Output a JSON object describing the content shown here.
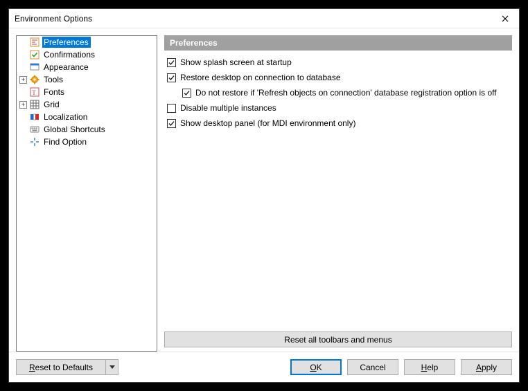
{
  "window": {
    "title": "Environment Options"
  },
  "tree": {
    "items": [
      {
        "label": "Preferences"
      },
      {
        "label": "Confirmations"
      },
      {
        "label": "Appearance"
      },
      {
        "label": "Tools"
      },
      {
        "label": "Fonts"
      },
      {
        "label": "Grid"
      },
      {
        "label": "Localization"
      },
      {
        "label": "Global Shortcuts"
      },
      {
        "label": "Find Option"
      }
    ]
  },
  "panel": {
    "header": "Preferences",
    "options": {
      "splash": "Show splash screen at startup",
      "restore": "Restore desktop on connection to database",
      "restore_sub": "Do not restore if 'Refresh objects on connection' database registration option is off",
      "disable_multi": "Disable multiple instances",
      "show_desktop": "Show desktop panel (for MDI environment only)"
    },
    "reset_toolbars": "Reset all toolbars and menus"
  },
  "buttons": {
    "reset_defaults": "Reset to Defaults",
    "cancel": "Cancel"
  }
}
